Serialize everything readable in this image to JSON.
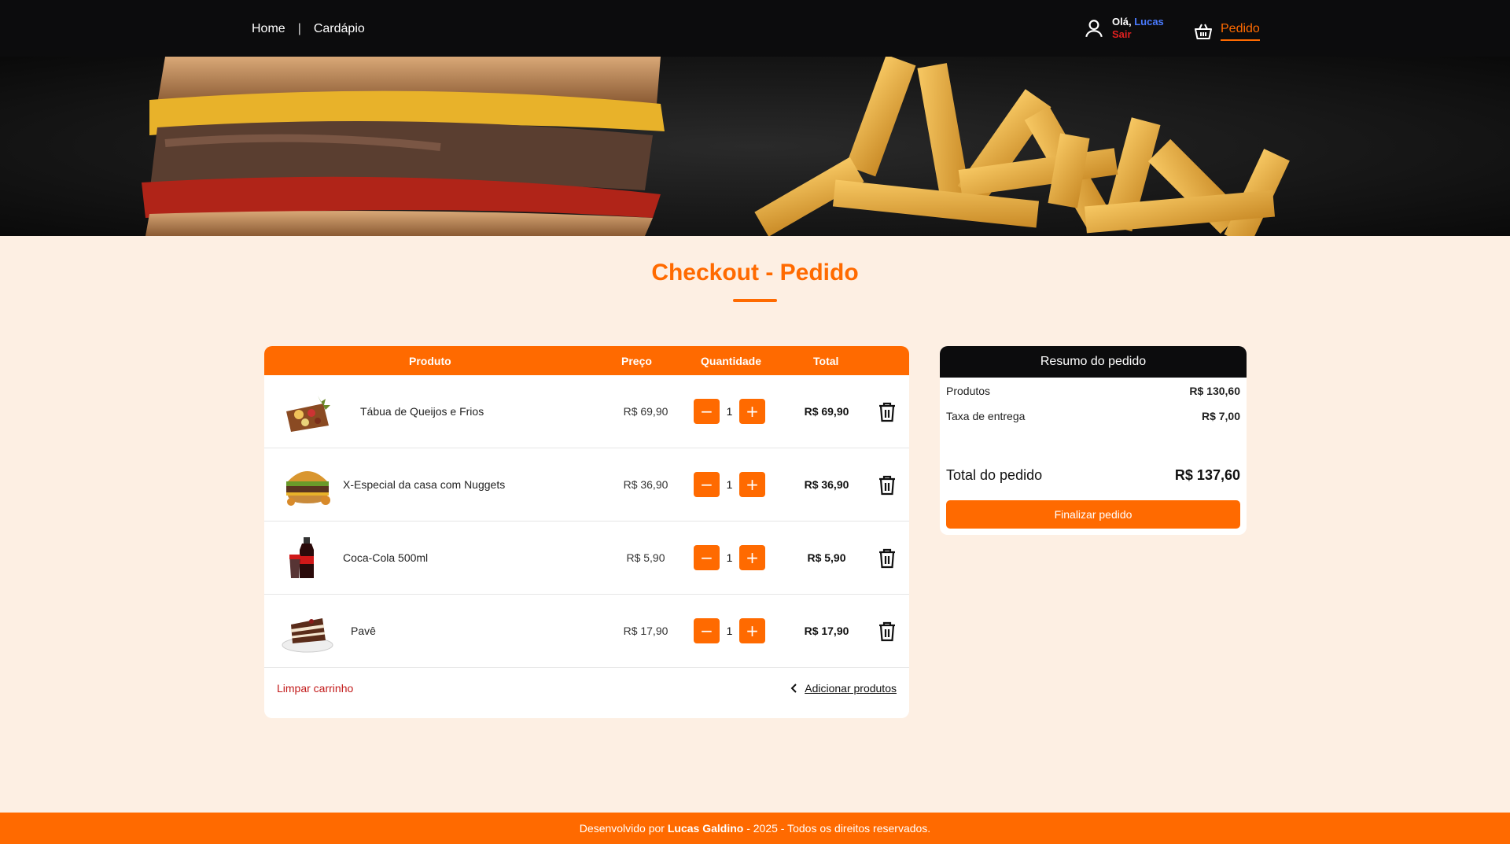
{
  "nav": {
    "home": "Home",
    "separator": "|",
    "menu": "Cardápio",
    "greeting": "Olá,",
    "user_name": "Lucas",
    "logout": "Sair",
    "cart": "Pedido"
  },
  "page": {
    "title": "Checkout - Pedido"
  },
  "table": {
    "headers": {
      "product": "Produto",
      "price": "Preço",
      "quantity": "Quantidade",
      "total": "Total"
    },
    "items": [
      {
        "name": "Tábua de Queijos e Frios",
        "price": "R$ 69,90",
        "quantity": "1",
        "total": "R$ 69,90",
        "icon": "cheese-board-image"
      },
      {
        "name": "X-Especial da casa com Nuggets",
        "price": "R$ 36,90",
        "quantity": "1",
        "total": "R$ 36,90",
        "icon": "burger-image"
      },
      {
        "name": "Coca-Cola 500ml",
        "price": "R$ 5,90",
        "quantity": "1",
        "total": "R$ 5,90",
        "icon": "soda-image"
      },
      {
        "name": "Pavê",
        "price": "R$ 17,90",
        "quantity": "1",
        "total": "R$ 17,90",
        "icon": "dessert-image"
      }
    ],
    "minus": "−",
    "plus": "+",
    "clear": "Limpar carrinho",
    "add": "Adicionar produtos"
  },
  "summary": {
    "title": "Resumo do pedido",
    "products_label": "Produtos",
    "products_value": "R$ 130,60",
    "delivery_label": "Taxa de entrega",
    "delivery_value": "R$ 7,00",
    "total_label": "Total do pedido",
    "total_value": "R$ 137,60",
    "finish": "Finalizar pedido"
  },
  "footer": {
    "prefix": "Desenvolvido por",
    "author": "Lucas Galdino",
    "suffix": "- 2025 - Todos os direitos reservados."
  },
  "colors": {
    "accent": "#ff6a00",
    "dark": "#0c0c0d",
    "background": "#fdefe3",
    "danger": "#c21a1a",
    "link_user": "#4a7bff"
  }
}
